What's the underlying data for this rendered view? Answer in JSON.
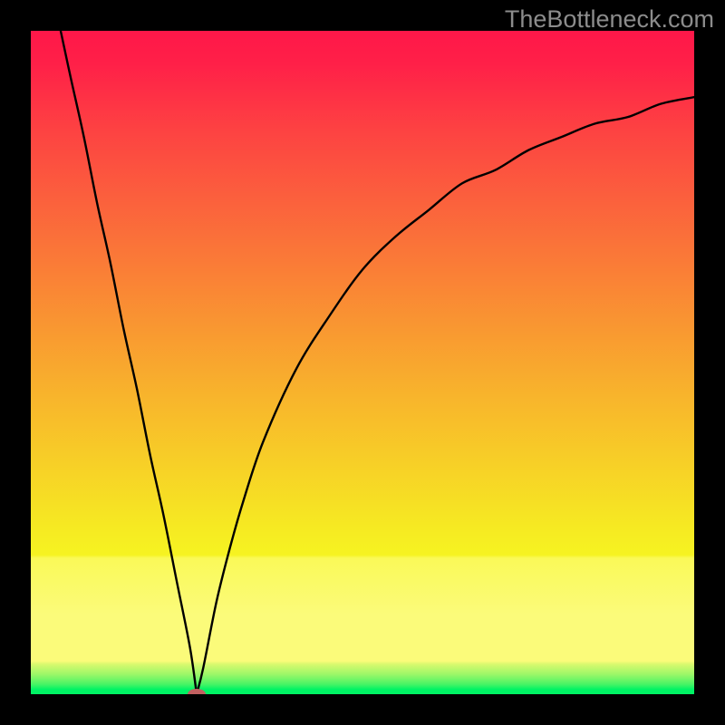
{
  "watermark": "TheBottleneck.com",
  "chart_data": {
    "type": "line",
    "xlim": [
      0,
      100
    ],
    "ylim": [
      0,
      100
    ],
    "x": [
      4.5,
      6,
      8,
      10,
      12,
      14,
      16,
      18,
      20,
      22,
      24,
      25,
      26,
      28,
      30,
      32,
      35,
      40,
      45,
      50,
      55,
      60,
      65,
      70,
      75,
      80,
      85,
      90,
      95,
      100
    ],
    "values": [
      100,
      93,
      84,
      74,
      65,
      55,
      46,
      36,
      27,
      17,
      7,
      0,
      4,
      14,
      22,
      29,
      38,
      49,
      57,
      64,
      69,
      73,
      77,
      79,
      82,
      84,
      86,
      87,
      89,
      90
    ],
    "curve_min_x": 25,
    "marker": {
      "x": 25,
      "y": 0,
      "rx": 10,
      "ry": 6,
      "color": "#c16060"
    },
    "base_band": {
      "y_frac_top": 0.993,
      "color": "#00f364"
    },
    "yellow_band": {
      "y_frac_top": 0.79,
      "y_frac_bottom": 0.95
    },
    "gradient_stops": [
      {
        "offset": 0.0,
        "color": "#ff1749"
      },
      {
        "offset": 0.05,
        "color": "#ff2048"
      },
      {
        "offset": 0.15,
        "color": "#fd4242"
      },
      {
        "offset": 0.25,
        "color": "#fb5f3d"
      },
      {
        "offset": 0.35,
        "color": "#fa7b37"
      },
      {
        "offset": 0.45,
        "color": "#f99831"
      },
      {
        "offset": 0.55,
        "color": "#f8b42c"
      },
      {
        "offset": 0.65,
        "color": "#f7cf27"
      },
      {
        "offset": 0.75,
        "color": "#f6ea22"
      },
      {
        "offset": 0.79,
        "color": "#f6f321"
      },
      {
        "offset": 0.795,
        "color": "#faf958"
      },
      {
        "offset": 0.88,
        "color": "#fbfb7a"
      },
      {
        "offset": 0.95,
        "color": "#fbfb7a"
      },
      {
        "offset": 0.955,
        "color": "#d8f96e"
      },
      {
        "offset": 0.97,
        "color": "#9cf768"
      },
      {
        "offset": 0.985,
        "color": "#48f465"
      },
      {
        "offset": 0.993,
        "color": "#00f364"
      },
      {
        "offset": 1.0,
        "color": "#00f364"
      }
    ]
  }
}
